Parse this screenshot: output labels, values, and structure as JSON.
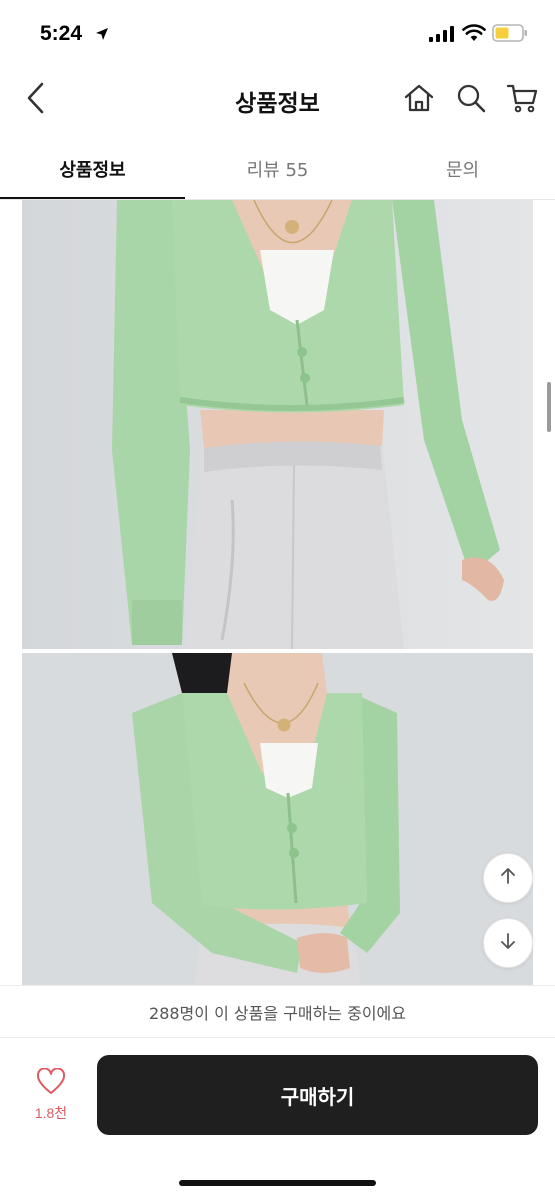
{
  "status_bar": {
    "time": "5:24",
    "icons": [
      "location-arrow-icon",
      "signal-bars-icon",
      "wifi-icon",
      "battery-icon"
    ],
    "battery_color": "#f5cf3d"
  },
  "header": {
    "title": "상품정보",
    "icons": [
      "back-icon",
      "home-icon",
      "search-icon",
      "cart-icon"
    ]
  },
  "tabs": [
    {
      "label": "상품정보",
      "active": true
    },
    {
      "label": "리뷰 55",
      "active": false
    },
    {
      "label": "문의",
      "active": false
    }
  ],
  "product_images": [
    {
      "name": "product-photo-mint-cardigan-front",
      "dominant_color": "#a8d4a6"
    },
    {
      "name": "product-photo-mint-cardigan-second",
      "dominant_color": "#a8d4a6"
    }
  ],
  "floating_buttons": [
    "arrow-up-icon",
    "arrow-down-icon"
  ],
  "purchase_info": {
    "text": "288명이 이 상품을 구매하는 중이에요"
  },
  "bottom_bar": {
    "like_count": "1.8천",
    "like_color": "#e05a63",
    "buy_label": "구매하기",
    "buy_color": "#1f1f1f"
  }
}
